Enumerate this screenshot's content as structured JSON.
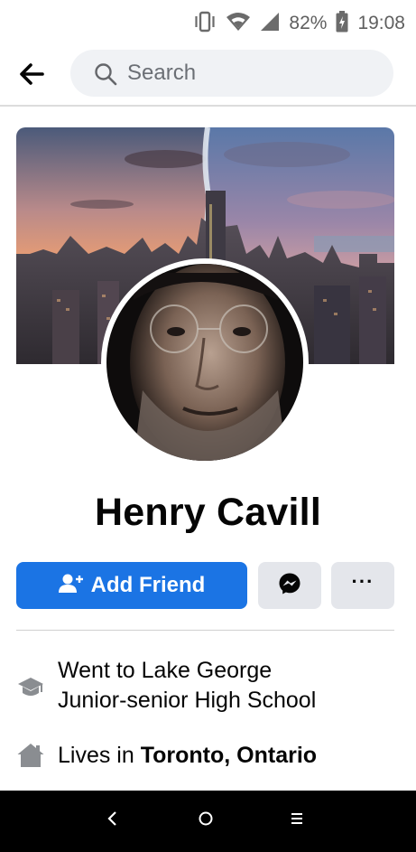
{
  "status_bar": {
    "battery": "82%",
    "time": "19:08",
    "icons": [
      "vibrate-icon",
      "wifi-icon",
      "signal-icon",
      "battery-charging-icon"
    ]
  },
  "top_nav": {
    "back_icon": "back-arrow-icon",
    "search_placeholder": "Search"
  },
  "profile": {
    "name": "Henry Cavill",
    "cover_photo": "city-skyline-sunset",
    "avatar": "profile-photo"
  },
  "actions": {
    "add_friend_label": "Add Friend",
    "message_icon": "messenger-icon",
    "more_label": "···"
  },
  "intro": {
    "education_line1": "Went to Lake George",
    "education_line2": "Junior-senior High School",
    "lives_prefix": "Lives in ",
    "lives_place": "Toronto, Ontario"
  },
  "nav_bar": {
    "icons": [
      "nav-back-icon",
      "nav-home-icon",
      "nav-menu-icon"
    ]
  },
  "colors": {
    "primary_blue": "#1b74e4",
    "secondary_button": "#e4e6eb",
    "search_bg": "#f0f2f5"
  }
}
